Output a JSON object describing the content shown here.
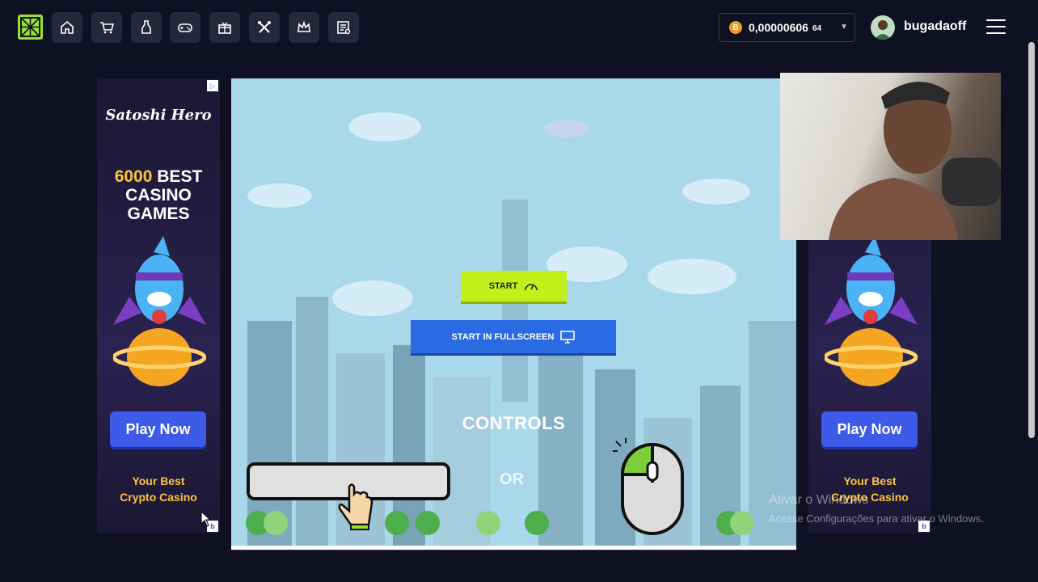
{
  "header": {
    "balance_value": "0,00000606",
    "balance_small": "64",
    "coin_symbol": "B",
    "username": "bugadaoff",
    "nav_icons": [
      "home-icon",
      "cart-icon",
      "potion-icon",
      "gamepad-icon",
      "gift-icon",
      "tools-icon",
      "crown-icon",
      "ticket-icon"
    ]
  },
  "ads": {
    "brand": "Satoshi Hero",
    "headline_number": "6000",
    "headline_rest": "BEST CASINO GAMES",
    "play_label": "Play Now",
    "tagline_line1": "Your Best",
    "tagline_line2": "Crypto Casino"
  },
  "game": {
    "start_label": "START",
    "fullscreen_label": "START IN FULLSCREEN",
    "controls_label": "CONTROLS",
    "or_label": "OR"
  },
  "watermark": {
    "line1": "Ativar o Windows",
    "line2": "Acesse Configurações para ativar o Windows."
  },
  "colors": {
    "background": "#0f1021",
    "accent_green": "#9be22d",
    "start_button": "#c2f01a",
    "fullscreen_button": "#2a6be3",
    "play_button": "#3d5be8",
    "gold_text": "#ffc43d",
    "sky": "#a9d8ea"
  }
}
